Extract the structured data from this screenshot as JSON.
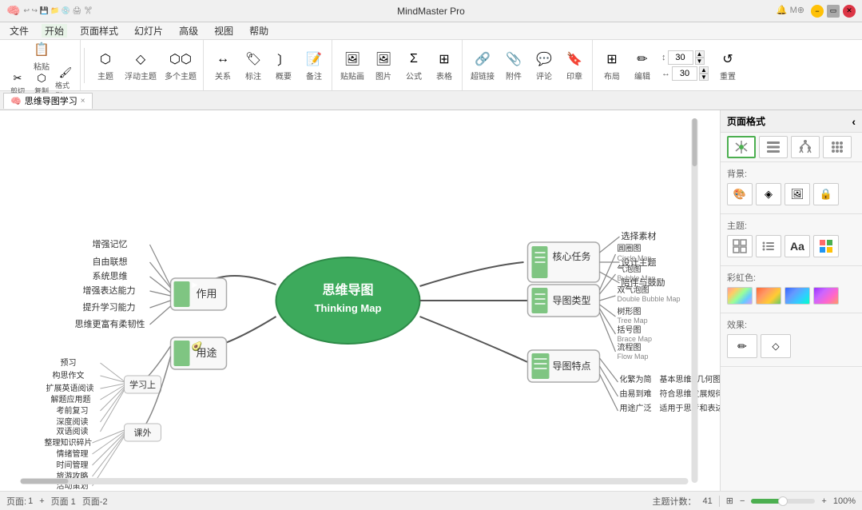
{
  "app": {
    "title": "MindMaster Pro",
    "tab_label": "思维导图学习",
    "close_label": "×"
  },
  "titlebar": {
    "title": "MindMaster Pro",
    "icons": [
      "minimize",
      "maximize",
      "close"
    ]
  },
  "menubar": {
    "items": [
      "文件",
      "开始",
      "页面样式",
      "幻灯片",
      "高级",
      "视图",
      "帮助"
    ]
  },
  "toolbar": {
    "paste_label": "粘贴",
    "cut_label": "剪切",
    "copy_label": "复制",
    "format_label": "格式刷",
    "style_label": "主题",
    "float_label": "浮动主题",
    "multi_label": "多个主题",
    "relation_label": "关系",
    "tag_label": "标注",
    "outline_label": "概要",
    "note_label": "备注",
    "sticker_label": "贴贴画",
    "image_label": "图片",
    "formula_label": "公式",
    "table_label": "表格",
    "hyperlink_label": "超链接",
    "attachment_label": "附件",
    "comment_label": "评论",
    "stamp_label": "印章",
    "layout_label": "布局",
    "edit_label": "编辑",
    "reset_label": "重置",
    "spinner1_value": "30",
    "spinner2_value": "30"
  },
  "rightpanel": {
    "title": "页面格式",
    "background_label": "背景:",
    "theme_label": "主题:",
    "color_label": "彩虹色:",
    "effect_label": "效果:",
    "layout_icons": [
      "grid",
      "list",
      "tree",
      "dots"
    ],
    "bg_icons": [
      "fill",
      "gradient",
      "image",
      "lock"
    ],
    "theme_icons": [
      "grid",
      "dots",
      "text",
      "color"
    ]
  },
  "statusbar": {
    "page_label": "页面:",
    "page_num": "1",
    "page_add": "+",
    "page_1": "页面 1",
    "page_2": "页面-2",
    "topic_count_label": "主题计数：",
    "topic_count": "41",
    "zoom": "100%"
  },
  "mindmap": {
    "center_text1": "思维导图",
    "center_text2": "Thinking Map",
    "branch1": {
      "label": "作用",
      "children": [
        "增强记忆",
        "自由联想",
        "系统思维",
        "增强表达能力",
        "提升学习能力",
        "思维更富有柔韧性"
      ]
    },
    "branch2": {
      "label": "用途",
      "sub1": {
        "label": "学习上",
        "children": [
          "预习",
          "构思作文",
          "扩展英语阅读",
          "解题应用题",
          "考前复习",
          "深度阅读",
          "双语阅读"
        ]
      },
      "sub2": {
        "label": "课外",
        "children": [
          "整理知识碎片",
          "情绪管理",
          "时间管理",
          "旅游攻略",
          "活动策划"
        ]
      }
    },
    "branch3": {
      "label": "核心任务",
      "children": [
        "选择素材",
        "设计主题",
        "陪伴与鼓励"
      ]
    },
    "branch4": {
      "label": "导图类型",
      "children": [
        {
          "zh": "圆圈图",
          "en": "Circle Map"
        },
        {
          "zh": "气泡图",
          "en": "Bubble Map"
        },
        {
          "zh": "双气泡图",
          "en": "Double Bubble Map"
        },
        {
          "zh": "树形图",
          "en": "Tree Map"
        },
        {
          "zh": "括号图",
          "en": "Brace Map"
        },
        {
          "zh": "流程图",
          "en": "Flow Map"
        }
      ]
    },
    "branch5": {
      "label": "导图特点",
      "rows": [
        {
          "col1": "化繁为简",
          "col2": "基本思维&几何图形"
        },
        {
          "col1": "由易到难",
          "col2": "符合思维发展规律"
        },
        {
          "col1": "用途广泛",
          "col2": "适用于思考和表达"
        }
      ]
    }
  }
}
